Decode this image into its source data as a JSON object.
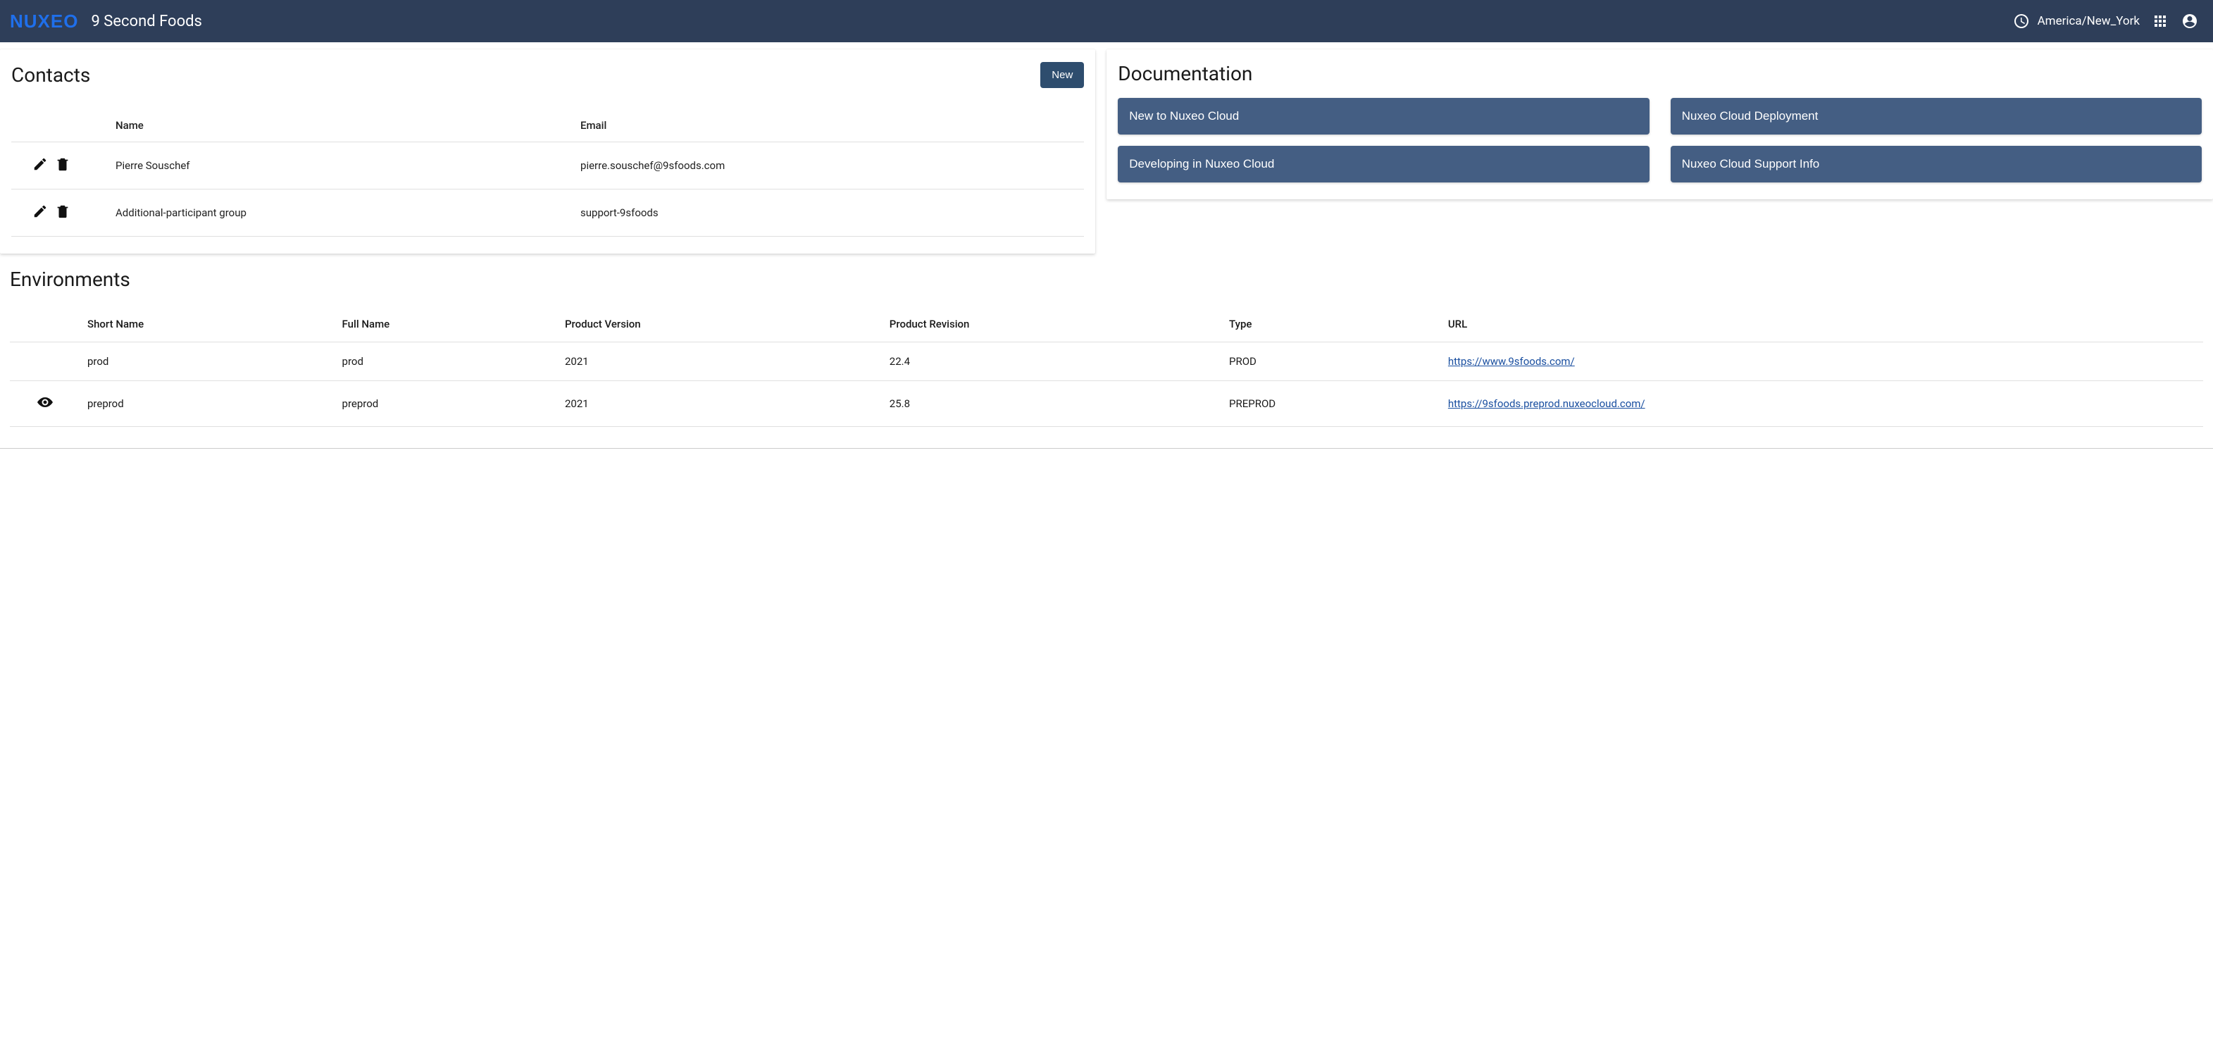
{
  "header": {
    "logo_text": "NUXEO",
    "app_title": "9 Second Foods",
    "timezone": "America/New_York"
  },
  "contacts": {
    "title": "Contacts",
    "new_button": "New",
    "columns": {
      "name": "Name",
      "email": "Email"
    },
    "rows": [
      {
        "name": "Pierre Souschef",
        "email": "pierre.souschef@9sfoods.com"
      },
      {
        "name": "Additional-participant group",
        "email": "support-9sfoods"
      }
    ]
  },
  "documentation": {
    "title": "Documentation",
    "links": [
      "New to Nuxeo Cloud",
      "Nuxeo Cloud Deployment",
      "Developing in Nuxeo Cloud",
      "Nuxeo Cloud Support Info"
    ]
  },
  "environments": {
    "title": "Environments",
    "columns": {
      "short_name": "Short Name",
      "full_name": "Full Name",
      "product_version": "Product Version",
      "product_revision": "Product Revision",
      "type": "Type",
      "url": "URL"
    },
    "rows": [
      {
        "has_eye": false,
        "short_name": "prod",
        "full_name": "prod",
        "product_version": "2021",
        "product_revision": "22.4",
        "type": "PROD",
        "url": "https://www.9sfoods.com/"
      },
      {
        "has_eye": true,
        "short_name": "preprod",
        "full_name": "preprod",
        "product_version": "2021",
        "product_revision": "25.8",
        "type": "PREPROD",
        "url": "https://9sfoods.preprod.nuxeocloud.com/"
      }
    ]
  }
}
